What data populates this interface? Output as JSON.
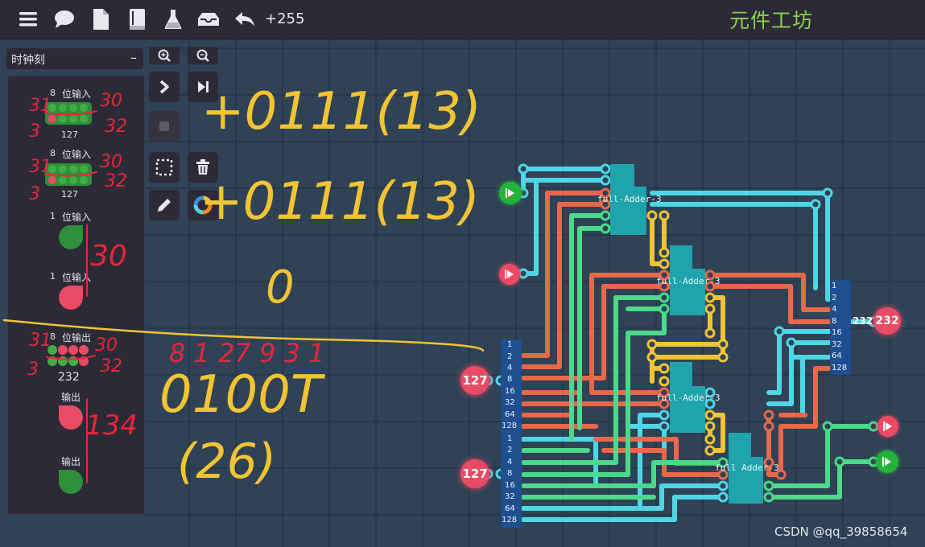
{
  "topbar": {
    "icons": [
      "menu-icon",
      "chat-icon",
      "document-icon",
      "book-icon",
      "flask-icon",
      "inbox-icon",
      "undo-icon"
    ],
    "count": "+255",
    "title": "元件工坊",
    "title_color": "#8bd24f"
  },
  "sidebar": {
    "dropdown_label": "时钟刻",
    "dropdown_toggle": "–",
    "items": [
      {
        "bits": "8",
        "label": "位输入",
        "value": "127"
      },
      {
        "bits": "8",
        "label": "位输入",
        "value": "127"
      },
      {
        "bits": "1",
        "label": "位输入"
      },
      {
        "bits": "1",
        "label": "位输入"
      },
      {
        "bits": "8",
        "label": "位输出",
        "value": "232"
      },
      {
        "label": "输出"
      },
      {
        "label": "输出"
      }
    ]
  },
  "tools": [
    "zoom-in",
    "zoom-out",
    "step",
    "run",
    "stop",
    "select",
    "delete",
    "pencil",
    "color-wheel"
  ],
  "circuit": {
    "adders": [
      "full-Adder-3",
      "full-Adder-3",
      "full-Adder-3",
      "full Adder-3"
    ],
    "input_a_value": "127",
    "input_b_value": "127",
    "output_value": "232",
    "output_value_small": "232",
    "bus_bits_left": [
      "1",
      "2",
      "4",
      "8",
      "16",
      "32",
      "64",
      "128"
    ],
    "bus_bits_left2": [
      "1",
      "2",
      "4",
      "8",
      "16",
      "32",
      "64",
      "128"
    ],
    "bus_bits_right": [
      "1",
      "2",
      "4",
      "8",
      "16",
      "32",
      "64",
      "128"
    ]
  },
  "handwriting": {
    "line1": "+0111(13)",
    "line2": "+0111(13)",
    "carry": "0",
    "weights": "8 1 27 9 3 1",
    "result": "0100T",
    "result_dec": "(26)",
    "note_30": "30",
    "note_134": "134",
    "ann_31": "31",
    "ann_30": "30",
    "ann_3": "3",
    "ann_32": "32"
  },
  "watermark": "CSDN @qq_39858654",
  "colors": {
    "cyan": "#4fd6e6",
    "orange": "#e8684a",
    "green": "#4bd98a",
    "yellow": "#f2c434",
    "red": "#e94a64",
    "darkgreen": "#2f8f3a",
    "teal": "#1fa3ad"
  }
}
